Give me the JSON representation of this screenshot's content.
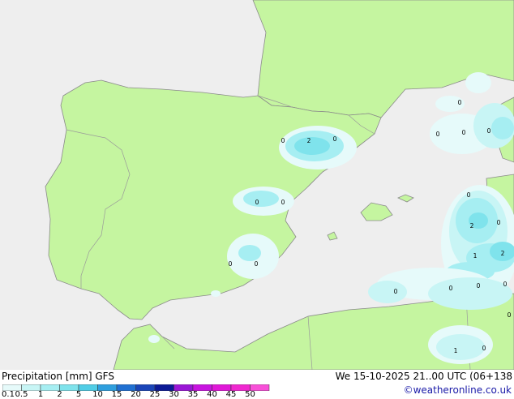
{
  "footer": {
    "title": "Precipitation [mm]  GFS",
    "datetime": "We 15-10-2025 21..00 UTC (06+138",
    "credit": "©weatheronline.co.uk"
  },
  "legend": {
    "labels": [
      "0.1",
      "0.5",
      "1",
      "2",
      "5",
      "10",
      "15",
      "20",
      "25",
      "30",
      "35",
      "40",
      "45",
      "50"
    ],
    "colors": [
      "#e6fafa",
      "#c8f5f5",
      "#a6eef2",
      "#7fe3ec",
      "#50cde6",
      "#2f9fde",
      "#2070d2",
      "#1a45b8",
      "#0c1a96",
      "#9a16d6",
      "#c814e0",
      "#e018d8",
      "#f028d0",
      "#f850d8"
    ]
  },
  "map": {
    "colors": {
      "sea": "#eeeeee",
      "land": "#c5f5a0",
      "border": "#9a9a9a",
      "coast": "#8a8a8a"
    },
    "point_labels": [
      {
        "id": "aragon-1",
        "text": "0"
      },
      {
        "id": "aragon-2",
        "text": "2"
      },
      {
        "id": "aragon-3",
        "text": "0"
      },
      {
        "id": "valencia-1",
        "text": "0"
      },
      {
        "id": "valencia-2",
        "text": "0"
      },
      {
        "id": "murcia-1",
        "text": "0"
      },
      {
        "id": "murcia-2",
        "text": "0"
      },
      {
        "id": "gulf-lion",
        "text": "0"
      },
      {
        "id": "baleares-n1",
        "text": "0"
      },
      {
        "id": "baleares-n2",
        "text": "0"
      },
      {
        "id": "baleares-n3",
        "text": "0"
      },
      {
        "id": "sardinia-1",
        "text": "0"
      },
      {
        "id": "sardinia-2",
        "text": "2"
      },
      {
        "id": "sardinia-3",
        "text": "0"
      },
      {
        "id": "sardinia-4",
        "text": "1"
      },
      {
        "id": "sardinia-5",
        "text": "2"
      },
      {
        "id": "sea-s1",
        "text": "0"
      },
      {
        "id": "sea-s2",
        "text": "0"
      },
      {
        "id": "sea-s3",
        "text": "0"
      },
      {
        "id": "sea-s4",
        "text": "0"
      },
      {
        "id": "tunisia-e",
        "text": "0"
      },
      {
        "id": "algeria-1",
        "text": "1"
      },
      {
        "id": "algeria-2",
        "text": "0"
      }
    ]
  }
}
